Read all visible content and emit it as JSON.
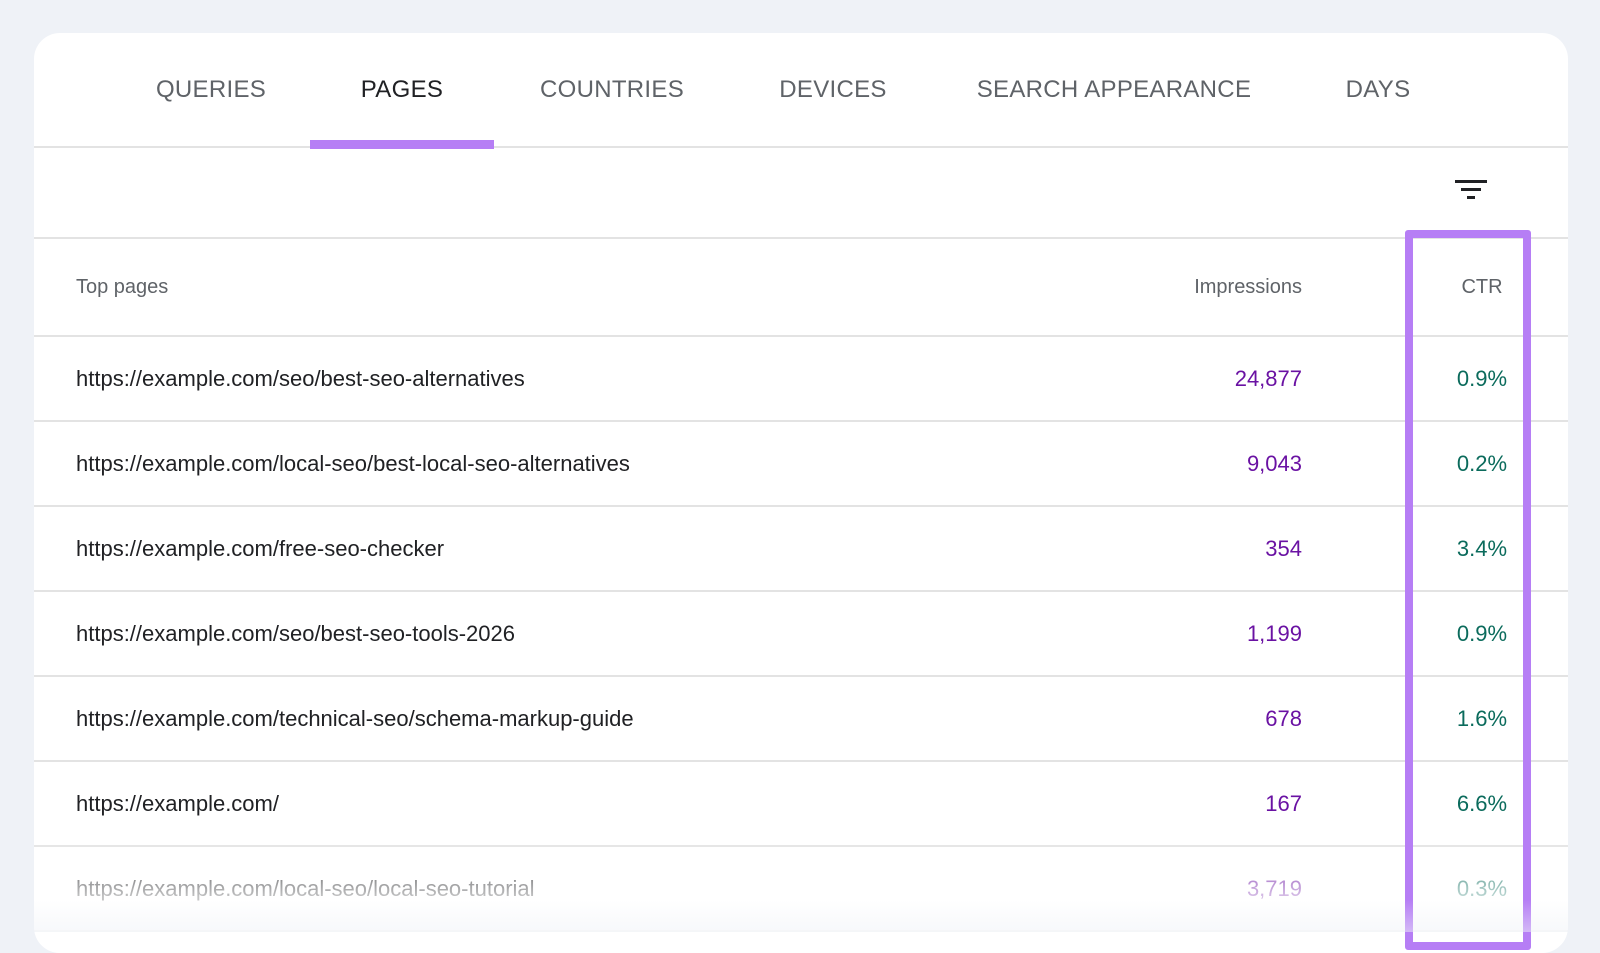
{
  "tabs": [
    {
      "label": "QUERIES",
      "active": false
    },
    {
      "label": "PAGES",
      "active": true
    },
    {
      "label": "COUNTRIES",
      "active": false
    },
    {
      "label": "DEVICES",
      "active": false
    },
    {
      "label": "SEARCH APPEARANCE",
      "active": false
    },
    {
      "label": "DAYS",
      "active": false
    }
  ],
  "toolbar": {
    "filter_icon": "filter-list-icon"
  },
  "table": {
    "headers": {
      "page": "Top pages",
      "impressions": "Impressions",
      "ctr": "CTR"
    },
    "rows": [
      {
        "page": "https://example.com/seo/best-seo-alternatives",
        "impressions": "24,877",
        "ctr": "0.9%"
      },
      {
        "page": "https://example.com/local-seo/best-local-seo-alternatives",
        "impressions": "9,043",
        "ctr": "0.2%"
      },
      {
        "page": "https://example.com/free-seo-checker",
        "impressions": "354",
        "ctr": "3.4%"
      },
      {
        "page": "https://example.com/seo/best-seo-tools-2026",
        "impressions": "1,199",
        "ctr": "0.9%"
      },
      {
        "page": "https://example.com/technical-seo/schema-markup-guide",
        "impressions": "678",
        "ctr": "1.6%"
      },
      {
        "page": "https://example.com/",
        "impressions": "167",
        "ctr": "6.6%"
      },
      {
        "page": "https://example.com/local-seo/local-seo-tutorial",
        "impressions": "3,719",
        "ctr": "0.3%"
      }
    ]
  },
  "colors": {
    "accent": "#b67ef5",
    "impressions_text": "#6a12a3",
    "ctr_text": "#0b6b5c",
    "background": "#eff2f7"
  }
}
